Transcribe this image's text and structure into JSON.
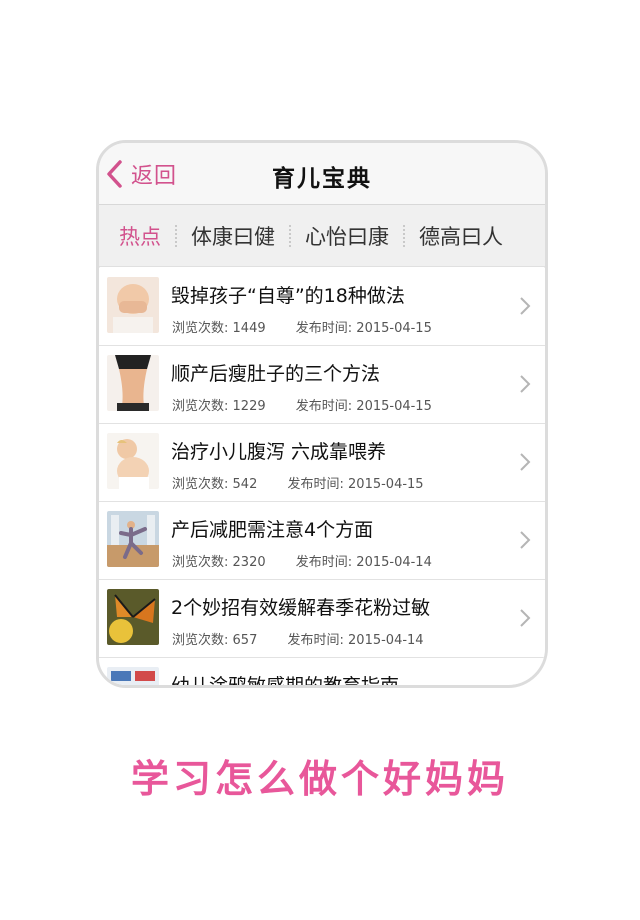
{
  "nav": {
    "back_label": "返回",
    "title": "育儿宝典"
  },
  "tabs": [
    {
      "label": "热点",
      "active": true
    },
    {
      "label": "体康曰健",
      "active": false
    },
    {
      "label": "心怡曰康",
      "active": false
    },
    {
      "label": "德高曰人",
      "active": false
    }
  ],
  "articles": [
    {
      "title": "毁掉孩子“自尊”的18种做法",
      "views_label": "浏览次数:",
      "views": "1449",
      "date_label": "发布时间:",
      "date": "2015-04-15",
      "thumb": "child-covering-mouth"
    },
    {
      "title": "顺产后瘦肚子的三个方法",
      "views_label": "浏览次数:",
      "views": "1229",
      "date_label": "发布时间:",
      "date": "2015-04-15",
      "thumb": "slim-waist"
    },
    {
      "title": "治疗小儿腹泻 六成靠喂养",
      "views_label": "浏览次数:",
      "views": "542",
      "date_label": "发布时间:",
      "date": "2015-04-15",
      "thumb": "baby-sitting"
    },
    {
      "title": "产后减肥需注意4个方面",
      "views_label": "浏览次数:",
      "views": "2320",
      "date_label": "发布时间:",
      "date": "2015-04-14",
      "thumb": "yoga-class"
    },
    {
      "title": "2个妙招有效缓解春季花粉过敏",
      "views_label": "浏览次数:",
      "views": "657",
      "date_label": "发布时间:",
      "date": "2015-04-14",
      "thumb": "butterfly-flower"
    },
    {
      "title": "幼儿涂鸦敏感期的教育指南",
      "thumb": "kids-drawing"
    }
  ],
  "tagline": "学习怎么做个好妈妈",
  "colors": {
    "accent": "#d2528d",
    "tagline": "#e8579a",
    "navbar_bg": "#f7f7f7",
    "tabs_bg": "#f0f0f0"
  }
}
